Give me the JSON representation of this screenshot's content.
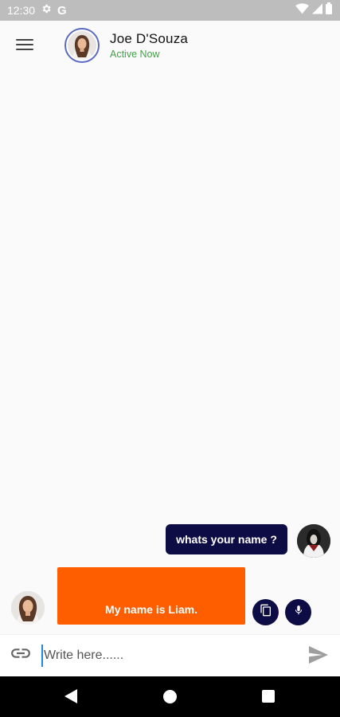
{
  "status_bar": {
    "time": "12:30",
    "google_letter": "G",
    "icons": [
      "gear-icon",
      "wifi-icon",
      "signal-icon",
      "battery-icon"
    ]
  },
  "header": {
    "contact_name": "Joe D'Souza",
    "contact_status": "Active Now",
    "menu_icon": "hamburger-menu-icon"
  },
  "messages": [
    {
      "sender": "user",
      "text": "whats your name ?"
    },
    {
      "sender": "bot",
      "text": "My name is Liam."
    }
  ],
  "message_actions": [
    "copy-icon",
    "microphone-icon"
  ],
  "composer": {
    "placeholder": "Write here......",
    "value": "",
    "attach_icon": "link-icon",
    "send_icon": "send-icon"
  },
  "nav_bar": [
    "back-icon",
    "home-icon",
    "recents-icon"
  ],
  "colors": {
    "sent_bubble": "#0d0c44",
    "received_bubble": "#ff5e00",
    "active_status": "#43a047",
    "status_bar": "#bdbdbd"
  }
}
